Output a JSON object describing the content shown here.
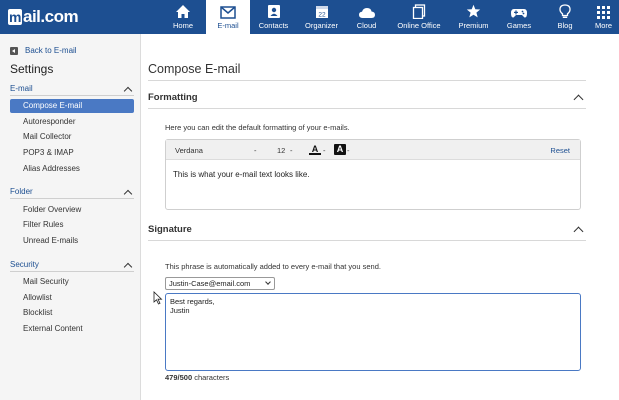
{
  "brand": {
    "logo_text": "mail.com",
    "logo_letter": "m",
    "logo_rest": "ail.com",
    "color": "#1d4f91"
  },
  "nav": [
    {
      "label": "Home",
      "icon": "home-icon",
      "active": false
    },
    {
      "label": "E-mail",
      "icon": "envelope-icon",
      "active": true
    },
    {
      "label": "Contacts",
      "icon": "contacts-icon",
      "active": false
    },
    {
      "label": "Organizer",
      "icon": "calendar-icon",
      "active": false
    },
    {
      "label": "Cloud",
      "icon": "cloud-icon",
      "active": false
    },
    {
      "label": "Online Office",
      "icon": "documents-icon",
      "active": false
    },
    {
      "label": "Premium",
      "icon": "star-icon",
      "active": false
    },
    {
      "label": "Games",
      "icon": "gamepad-icon",
      "active": false
    },
    {
      "label": "Blog",
      "icon": "lightbulb-icon",
      "active": false
    },
    {
      "label": "More",
      "icon": "grid-icon",
      "active": false
    }
  ],
  "sidebar": {
    "back_label": "Back to E-mail",
    "title": "Settings",
    "sections": [
      {
        "label": "E-mail",
        "items": [
          "Compose E-mail",
          "Autoresponder",
          "Mail Collector",
          "POP3 & IMAP",
          "Alias Addresses"
        ],
        "active": "Compose E-mail"
      },
      {
        "label": "Folder",
        "items": [
          "Folder Overview",
          "Filter Rules",
          "Unread E-mails"
        ]
      },
      {
        "label": "Security",
        "items": [
          "Mail Security",
          "Allowlist",
          "Blocklist",
          "External Content"
        ]
      }
    ]
  },
  "main": {
    "title": "Compose E-mail",
    "formatting": {
      "heading": "Formatting",
      "description": "Here you can edit the default formatting of your e-mails.",
      "font": "Verdana",
      "font_sep": "-",
      "size": "12",
      "size_sep": "-",
      "color_sep": "-",
      "bg_sep": "-",
      "reset_label": "Reset",
      "preview_text": "This is what your e-mail text looks like."
    },
    "signature": {
      "heading": "Signature",
      "description": "This phrase is automatically added to every e-mail that you send.",
      "selected_address": "Justin-Case@email.com",
      "text": "Best regards,\nJustin",
      "count": "479/500",
      "count_suffix": "characters"
    }
  }
}
